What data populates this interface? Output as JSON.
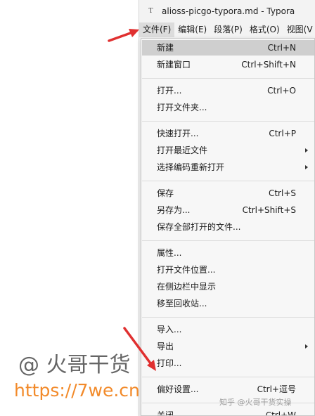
{
  "window": {
    "title": "alioss-picgo-typora.md - Typora",
    "icon": "typora-doc-icon"
  },
  "menubar": {
    "items": [
      {
        "label": "文件(F)",
        "active": true
      },
      {
        "label": "编辑(E)",
        "active": false
      },
      {
        "label": "段落(P)",
        "active": false
      },
      {
        "label": "格式(O)",
        "active": false
      },
      {
        "label": "视图(V",
        "active": false
      }
    ]
  },
  "file_menu": {
    "groups": [
      [
        {
          "label": "新建",
          "shortcut": "Ctrl+N",
          "highlighted": true
        },
        {
          "label": "新建窗口",
          "shortcut": "Ctrl+Shift+N"
        }
      ],
      [
        {
          "label": "打开...",
          "shortcut": "Ctrl+O"
        },
        {
          "label": "打开文件夹...",
          "shortcut": ""
        }
      ],
      [
        {
          "label": "快速打开...",
          "shortcut": "Ctrl+P"
        },
        {
          "label": "打开最近文件",
          "shortcut": "",
          "submenu": true
        },
        {
          "label": "选择编码重新打开",
          "shortcut": "",
          "submenu": true
        }
      ],
      [
        {
          "label": "保存",
          "shortcut": "Ctrl+S"
        },
        {
          "label": "另存为...",
          "shortcut": "Ctrl+Shift+S"
        },
        {
          "label": "保存全部打开的文件...",
          "shortcut": ""
        }
      ],
      [
        {
          "label": "属性...",
          "shortcut": ""
        },
        {
          "label": "打开文件位置...",
          "shortcut": ""
        },
        {
          "label": "在侧边栏中显示",
          "shortcut": ""
        },
        {
          "label": "移至回收站...",
          "shortcut": ""
        }
      ],
      [
        {
          "label": "导入...",
          "shortcut": ""
        },
        {
          "label": "导出",
          "shortcut": "",
          "submenu": true
        },
        {
          "label": "打印...",
          "shortcut": ""
        }
      ],
      [
        {
          "label": "偏好设置...",
          "shortcut": "Ctrl+逗号"
        }
      ],
      [
        {
          "label": "关闭",
          "shortcut": "Ctrl+W"
        }
      ]
    ]
  },
  "watermarks": {
    "handle": "@ 火哥干货",
    "url": "https://7we.cn",
    "zhihu": "知乎 @火哥干货实操"
  },
  "colors": {
    "annotation_arrow": "#e03030",
    "url_watermark": "#f28a2a",
    "highlight": "#cfcfcf"
  }
}
